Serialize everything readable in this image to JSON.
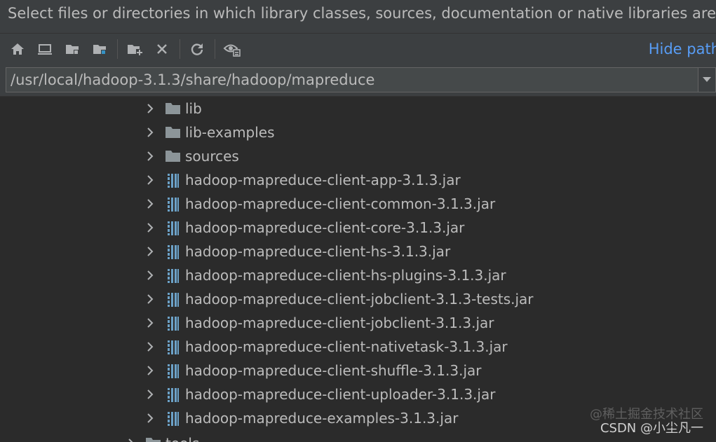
{
  "dialog": {
    "description": "Select files or directories in which library classes, sources, documentation or native libraries are located"
  },
  "toolbar": {
    "buttons": [
      {
        "name": "home-button",
        "icon": "home-icon"
      },
      {
        "name": "desktop-button",
        "icon": "desktop-icon"
      },
      {
        "name": "project-button",
        "icon": "project-folder-icon"
      },
      {
        "name": "module-button",
        "icon": "module-folder-icon"
      },
      {
        "name": "new-folder-button",
        "icon": "new-folder-icon"
      },
      {
        "name": "delete-button",
        "icon": "delete-icon"
      },
      {
        "name": "refresh-button",
        "icon": "refresh-icon"
      },
      {
        "name": "show-hidden-button",
        "icon": "show-hidden-icon"
      }
    ],
    "hide_path_label": "Hide path"
  },
  "path": {
    "value": "/usr/local/hadoop-3.1.3/share/hadoop/mapreduce"
  },
  "tree": {
    "items": [
      {
        "label": "lib",
        "type": "folder"
      },
      {
        "label": "lib-examples",
        "type": "folder"
      },
      {
        "label": "sources",
        "type": "folder"
      },
      {
        "label": "hadoop-mapreduce-client-app-3.1.3.jar",
        "type": "jar"
      },
      {
        "label": "hadoop-mapreduce-client-common-3.1.3.jar",
        "type": "jar"
      },
      {
        "label": "hadoop-mapreduce-client-core-3.1.3.jar",
        "type": "jar"
      },
      {
        "label": "hadoop-mapreduce-client-hs-3.1.3.jar",
        "type": "jar"
      },
      {
        "label": "hadoop-mapreduce-client-hs-plugins-3.1.3.jar",
        "type": "jar"
      },
      {
        "label": "hadoop-mapreduce-client-jobclient-3.1.3-tests.jar",
        "type": "jar"
      },
      {
        "label": "hadoop-mapreduce-client-jobclient-3.1.3.jar",
        "type": "jar"
      },
      {
        "label": "hadoop-mapreduce-client-nativetask-3.1.3.jar",
        "type": "jar"
      },
      {
        "label": "hadoop-mapreduce-client-shuffle-3.1.3.jar",
        "type": "jar"
      },
      {
        "label": "hadoop-mapreduce-client-uploader-3.1.3.jar",
        "type": "jar"
      },
      {
        "label": "hadoop-mapreduce-examples-3.1.3.jar",
        "type": "jar"
      }
    ],
    "partial_item": {
      "label": "tools",
      "type": "folder"
    }
  },
  "watermark": {
    "line1": "@稀土掘金技术社区",
    "line2": "CSDN @小尘凡一"
  },
  "colors": {
    "background": "#3c3f41",
    "tree_background": "#2b2b2b",
    "text": "#bbbbbb",
    "link": "#589df6",
    "folder": "#8c9599",
    "jar": "#6ca2c8"
  }
}
